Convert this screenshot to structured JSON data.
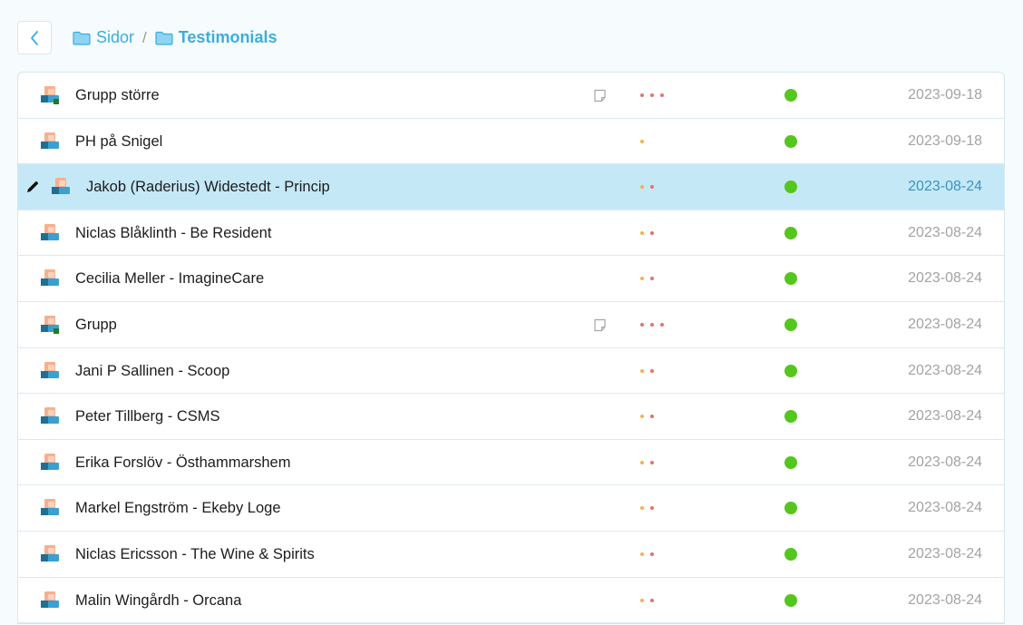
{
  "breadcrumb": {
    "items": [
      {
        "label": "Sidor"
      },
      {
        "label": "Testimonials"
      }
    ],
    "separator": "/"
  },
  "colors": {
    "accent": "#3aaedc",
    "status_green": "#55c61d",
    "selected_row": "#c5e8f7",
    "dot_orange": "#f5b04d",
    "dot_red": "#e8706a"
  },
  "rows": [
    {
      "title": "Grupp större",
      "date": "2023-09-18",
      "dots": [
        "red",
        "red",
        "red"
      ],
      "note": true,
      "selected": false,
      "icon": "group-page-icon"
    },
    {
      "title": "PH på Snigel",
      "date": "2023-09-18",
      "dots": [
        "orange"
      ],
      "note": false,
      "selected": false,
      "icon": "page-icon"
    },
    {
      "title": "Jakob (Raderius) Widestedt - Princip",
      "date": "2023-08-24",
      "dots": [
        "orange",
        "red"
      ],
      "note": false,
      "selected": true,
      "icon": "page-icon"
    },
    {
      "title": "Niclas Blåklinth - Be Resident",
      "date": "2023-08-24",
      "dots": [
        "orange",
        "red"
      ],
      "note": false,
      "selected": false,
      "icon": "page-icon"
    },
    {
      "title": "Cecilia Meller - ImagineCare",
      "date": "2023-08-24",
      "dots": [
        "orange",
        "red"
      ],
      "note": false,
      "selected": false,
      "icon": "page-icon"
    },
    {
      "title": "Grupp",
      "date": "2023-08-24",
      "dots": [
        "red",
        "red",
        "red"
      ],
      "note": true,
      "selected": false,
      "icon": "group-page-icon"
    },
    {
      "title": "Jani P Sallinen - Scoop",
      "date": "2023-08-24",
      "dots": [
        "orange",
        "red"
      ],
      "note": false,
      "selected": false,
      "icon": "page-icon"
    },
    {
      "title": "Peter Tillberg - CSMS",
      "date": "2023-08-24",
      "dots": [
        "orange",
        "red"
      ],
      "note": false,
      "selected": false,
      "icon": "page-icon"
    },
    {
      "title": "Erika Forslöv - Östhammarshem",
      "date": "2023-08-24",
      "dots": [
        "orange",
        "red"
      ],
      "note": false,
      "selected": false,
      "icon": "page-icon"
    },
    {
      "title": "Markel Engström - Ekeby Loge",
      "date": "2023-08-24",
      "dots": [
        "orange",
        "red"
      ],
      "note": false,
      "selected": false,
      "icon": "page-icon"
    },
    {
      "title": "Niclas Ericsson - The Wine & Spirits",
      "date": "2023-08-24",
      "dots": [
        "orange",
        "red"
      ],
      "note": false,
      "selected": false,
      "icon": "page-icon"
    },
    {
      "title": "Malin Wingårdh - Orcana",
      "date": "2023-08-24",
      "dots": [
        "orange",
        "red"
      ],
      "note": false,
      "selected": false,
      "icon": "page-icon"
    }
  ]
}
